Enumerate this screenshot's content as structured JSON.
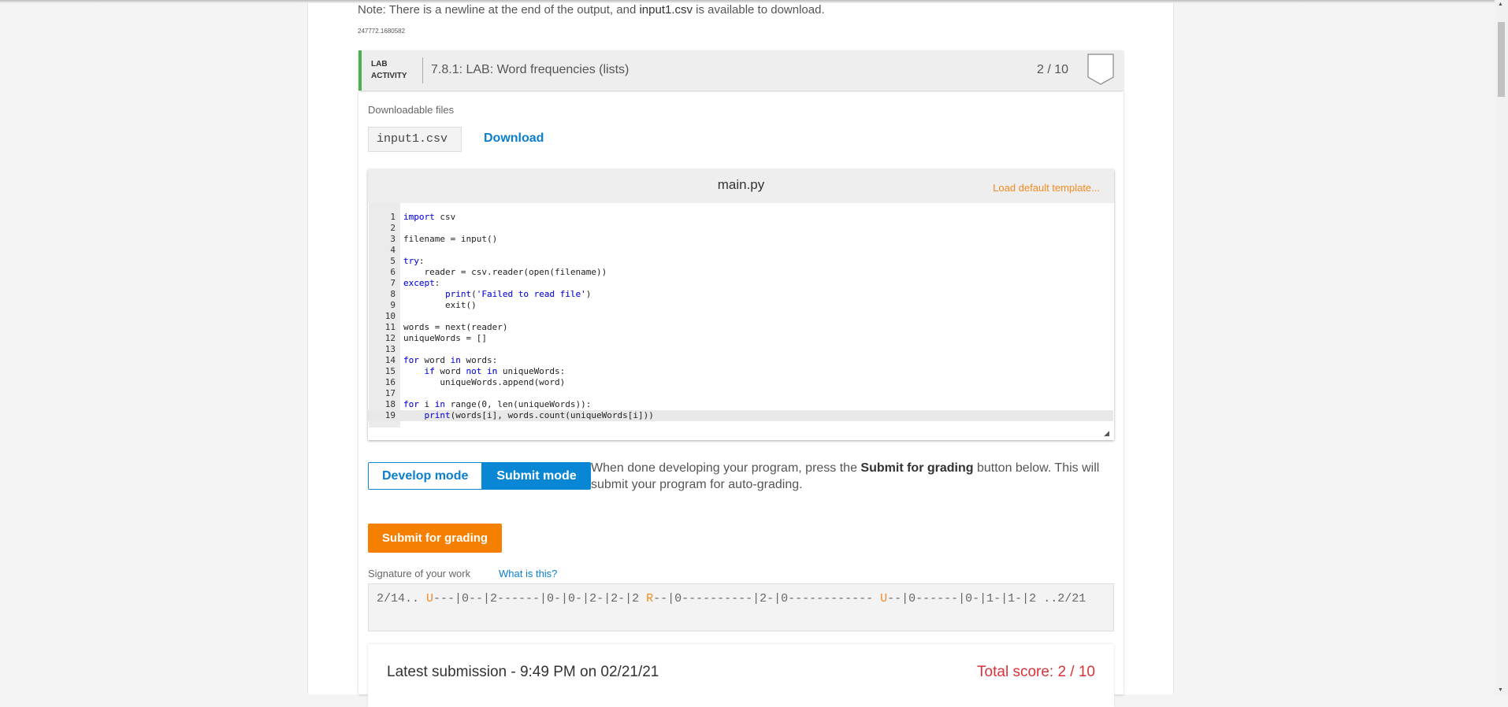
{
  "note": {
    "prefix": "Note: There is a newline at the end of the output, and ",
    "file": "input1.csv",
    "suffix": " is available to download."
  },
  "activity_id": "247772.1680582",
  "lab": {
    "tag_line1": "LAB",
    "tag_line2": "ACTIVITY",
    "title": "7.8.1: LAB: Word frequencies (lists)",
    "score": "2 / 10",
    "accent": "#4caf50"
  },
  "downloads": {
    "label": "Downloadable files",
    "file": "input1.csv",
    "download_label": "Download"
  },
  "editor": {
    "filename": "main.py",
    "load_template": "Load default template...",
    "active_line": 19,
    "lines": [
      "import csv",
      "",
      "filename = input()",
      "",
      "try:",
      "    reader = csv.reader(open(filename))",
      "except:",
      "        print('Failed to read file')",
      "        exit()",
      "",
      "words = next(reader)",
      "uniqueWords = []",
      "",
      "for word in words:",
      "    if word not in uniqueWords:",
      "       uniqueWords.append(word)",
      "",
      "for i in range(0, len(uniqueWords)):",
      "    print(words[i], words.count(uniqueWords[i]))"
    ]
  },
  "modes": {
    "develop": "Develop mode",
    "submit": "Submit mode",
    "selected": "submit"
  },
  "description": {
    "before": "When done developing your program, press the ",
    "bold": "Submit for grading",
    "after": " button below. This will submit your program for auto-grading."
  },
  "submit_button": "Submit for grading",
  "signature": {
    "label": "Signature of your work",
    "help_link": "What is this?",
    "segments": [
      {
        "text": "2/14.. ",
        "hl": false
      },
      {
        "text": "U",
        "hl": true
      },
      {
        "text": "---|0--|2------|0-|0-|2-|2-|2 ",
        "hl": false
      },
      {
        "text": "R",
        "hl": true
      },
      {
        "text": "--|0----------|2-|0------------ ",
        "hl": false
      },
      {
        "text": "U",
        "hl": true
      },
      {
        "text": "--|0------|0-|1-|1-|2 ..2/21",
        "hl": false
      }
    ]
  },
  "latest": {
    "text": "Latest submission - 9:49 PM on 02/21/21",
    "score": "Total score: 2 / 10"
  },
  "colors": {
    "primary": "#0a87d4",
    "orange": "#f57f00",
    "score_red": "#d9333a"
  }
}
